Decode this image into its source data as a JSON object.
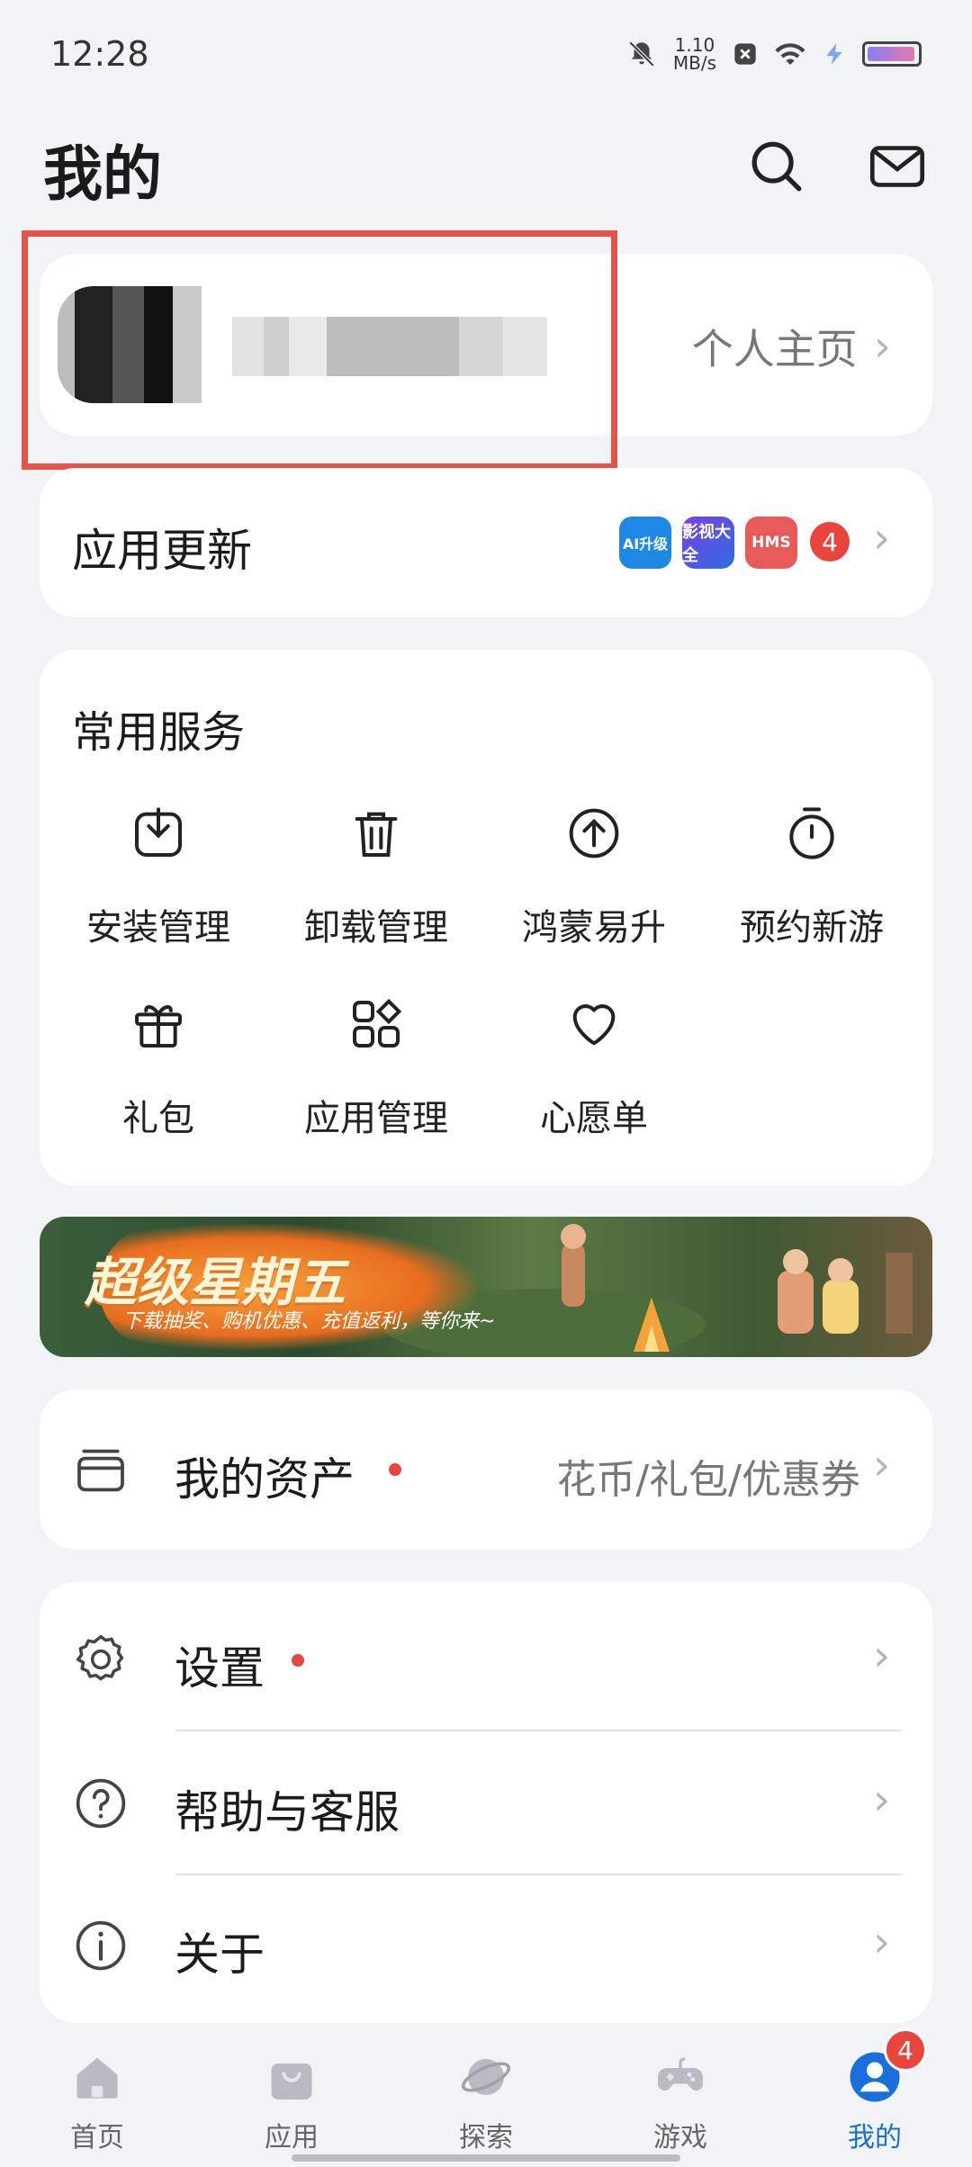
{
  "status": {
    "time": "12:28",
    "net_speed_value": "1.10",
    "net_speed_unit": "MB/s",
    "icons": [
      "bell-off-icon",
      "notification-x-icon",
      "wifi-icon",
      "charging-icon",
      "battery-icon"
    ]
  },
  "header": {
    "title": "我的",
    "icons": [
      "search-icon",
      "mail-icon"
    ]
  },
  "profile": {
    "homepage_label": "个人主页"
  },
  "app_update": {
    "label": "应用更新",
    "app_icons": [
      "AI升级",
      "影视大全",
      "HMS"
    ],
    "count": "4"
  },
  "services": {
    "title": "常用服务",
    "items": [
      {
        "label": "安装管理",
        "icon": "install-download-icon"
      },
      {
        "label": "卸载管理",
        "icon": "trash-icon"
      },
      {
        "label": "鸿蒙易升",
        "icon": "upgrade-arrow-icon"
      },
      {
        "label": "预约新游",
        "icon": "stopwatch-icon"
      },
      {
        "label": "礼包",
        "icon": "gift-icon"
      },
      {
        "label": "应用管理",
        "icon": "app-grid-icon"
      },
      {
        "label": "心愿单",
        "icon": "heart-icon"
      }
    ]
  },
  "banner": {
    "title": "超级星期五",
    "subtitle": "下载抽奖、购机优惠、充值返利，等你来~"
  },
  "assets": {
    "label": "我的资产",
    "detail": "花币/礼包/优惠券"
  },
  "settings_list": [
    {
      "label": "设置",
      "icon": "gear-icon",
      "has_dot": true
    },
    {
      "label": "帮助与客服",
      "icon": "help-icon",
      "has_dot": false
    },
    {
      "label": "关于",
      "icon": "info-icon",
      "has_dot": false
    }
  ],
  "tabs": [
    {
      "label": "首页",
      "icon": "home-icon"
    },
    {
      "label": "应用",
      "icon": "app-bag-icon"
    },
    {
      "label": "探索",
      "icon": "planet-icon"
    },
    {
      "label": "游戏",
      "icon": "gamepad-icon"
    },
    {
      "label": "我的",
      "icon": "user-icon",
      "active": true,
      "badge": "4"
    }
  ],
  "colors": {
    "accent": "#1a6fd8",
    "badge_red": "#e8453c",
    "highlight_red": "#e5534b",
    "background": "#f1f3f5"
  }
}
